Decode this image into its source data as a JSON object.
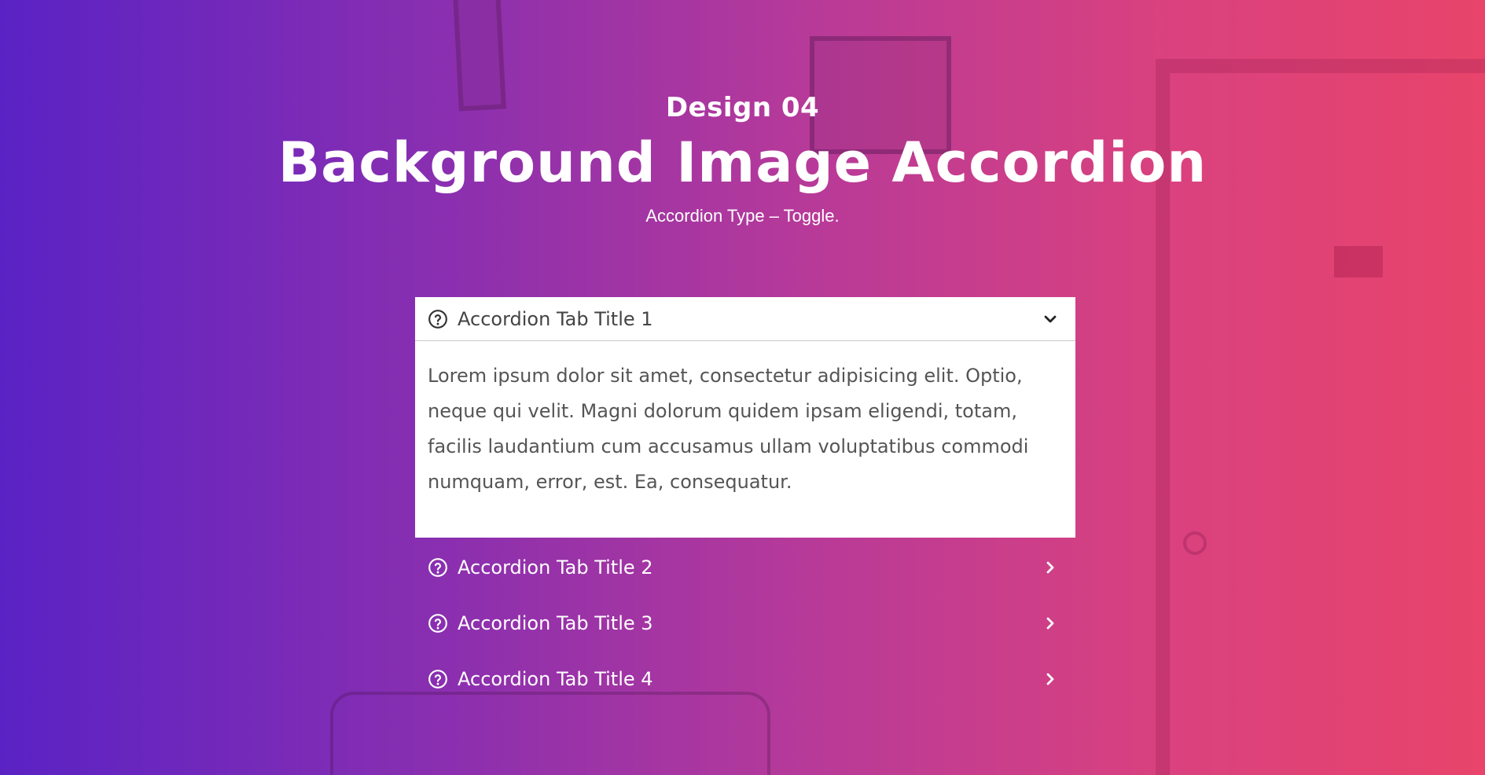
{
  "header": {
    "kicker": "Design 04",
    "title": "Background Image Accordion",
    "subtitle": "Accordion Type – Toggle."
  },
  "accordion": {
    "items": [
      {
        "title": "Accordion Tab Title 1",
        "expanded": true,
        "body": "Lorem ipsum dolor sit amet, consectetur adipisicing elit. Optio, neque qui velit. Magni dolorum quidem ipsam eligendi, totam, facilis laudantium cum accusamus ullam voluptatibus commodi numquam, error, est. Ea, consequatur."
      },
      {
        "title": "Accordion Tab Title 2",
        "expanded": false
      },
      {
        "title": "Accordion Tab Title 3",
        "expanded": false
      },
      {
        "title": "Accordion Tab Title 4",
        "expanded": false
      }
    ],
    "icons": {
      "item_icon": "question-circle-icon",
      "open_indicator": "chevron-down-icon",
      "closed_indicator": "chevron-right-icon"
    }
  },
  "colors": {
    "gradient_start": "#5a22c4",
    "gradient_end": "#e8446b",
    "panel_background": "#ffffff",
    "open_title_text": "#444444",
    "body_text": "#555555",
    "closed_title_text": "#ffffff"
  }
}
